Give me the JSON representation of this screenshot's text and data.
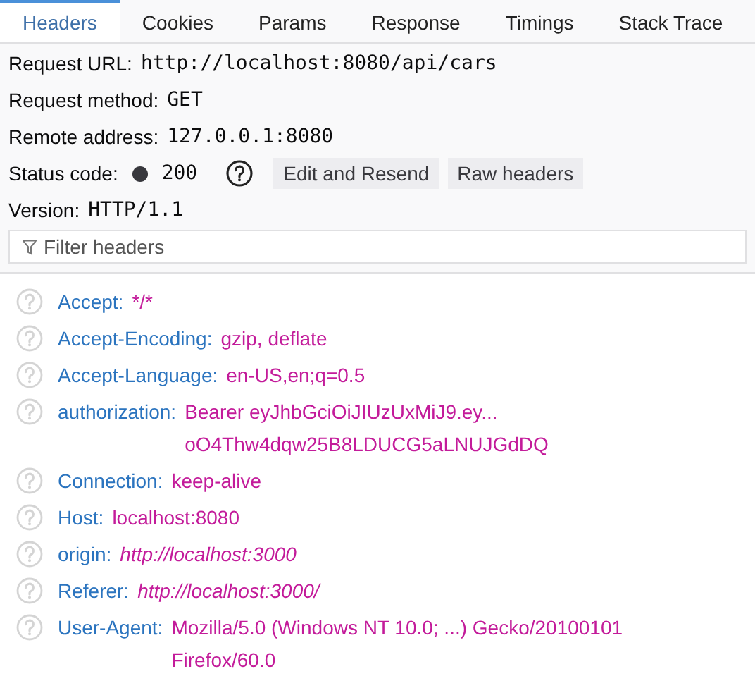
{
  "tabs": [
    {
      "label": "Headers",
      "selected": true
    },
    {
      "label": "Cookies",
      "selected": false
    },
    {
      "label": "Params",
      "selected": false
    },
    {
      "label": "Response",
      "selected": false
    },
    {
      "label": "Timings",
      "selected": false
    },
    {
      "label": "Stack Trace",
      "selected": false
    }
  ],
  "summary": [
    {
      "kind": "text",
      "label": "Request URL:",
      "value": "http://localhost:8080/api/cars"
    },
    {
      "kind": "text",
      "label": "Request method:",
      "value": "GET"
    },
    {
      "kind": "text",
      "label": "Remote address:",
      "value": "127.0.0.1:8080"
    },
    {
      "kind": "status",
      "label": "Status code:",
      "value": "200",
      "buttons": [
        "Edit and Resend",
        "Raw headers"
      ]
    },
    {
      "kind": "text",
      "label": "Version:",
      "value": "HTTP/1.1"
    }
  ],
  "filter": {
    "placeholder": "Filter headers"
  },
  "headers": [
    {
      "name": "Accept:",
      "lines": [
        "*/*"
      ],
      "italic": false
    },
    {
      "name": "Accept-Encoding:",
      "lines": [
        "gzip, deflate"
      ],
      "italic": false
    },
    {
      "name": "Accept-Language:",
      "lines": [
        "en-US,en;q=0.5"
      ],
      "italic": false
    },
    {
      "name": "authorization:",
      "lines": [
        "Bearer eyJhbGciOiJIUzUxMiJ9.ey...",
        "oO4Thw4dqw25B8LDUCG5aLNUJGdDQ"
      ],
      "italic": false
    },
    {
      "name": "Connection:",
      "lines": [
        "keep-alive"
      ],
      "italic": false
    },
    {
      "name": "Host:",
      "lines": [
        "localhost:8080"
      ],
      "italic": false
    },
    {
      "name": "origin:",
      "lines": [
        "http://localhost:3000"
      ],
      "italic": true
    },
    {
      "name": "Referer:",
      "lines": [
        "http://localhost:3000/"
      ],
      "italic": true
    },
    {
      "name": "User-Agent:",
      "lines": [
        "Mozilla/5.0 (Windows NT 10.0; ...) Gecko/20100101",
        "Firefox/60.0"
      ],
      "italic": false
    }
  ]
}
